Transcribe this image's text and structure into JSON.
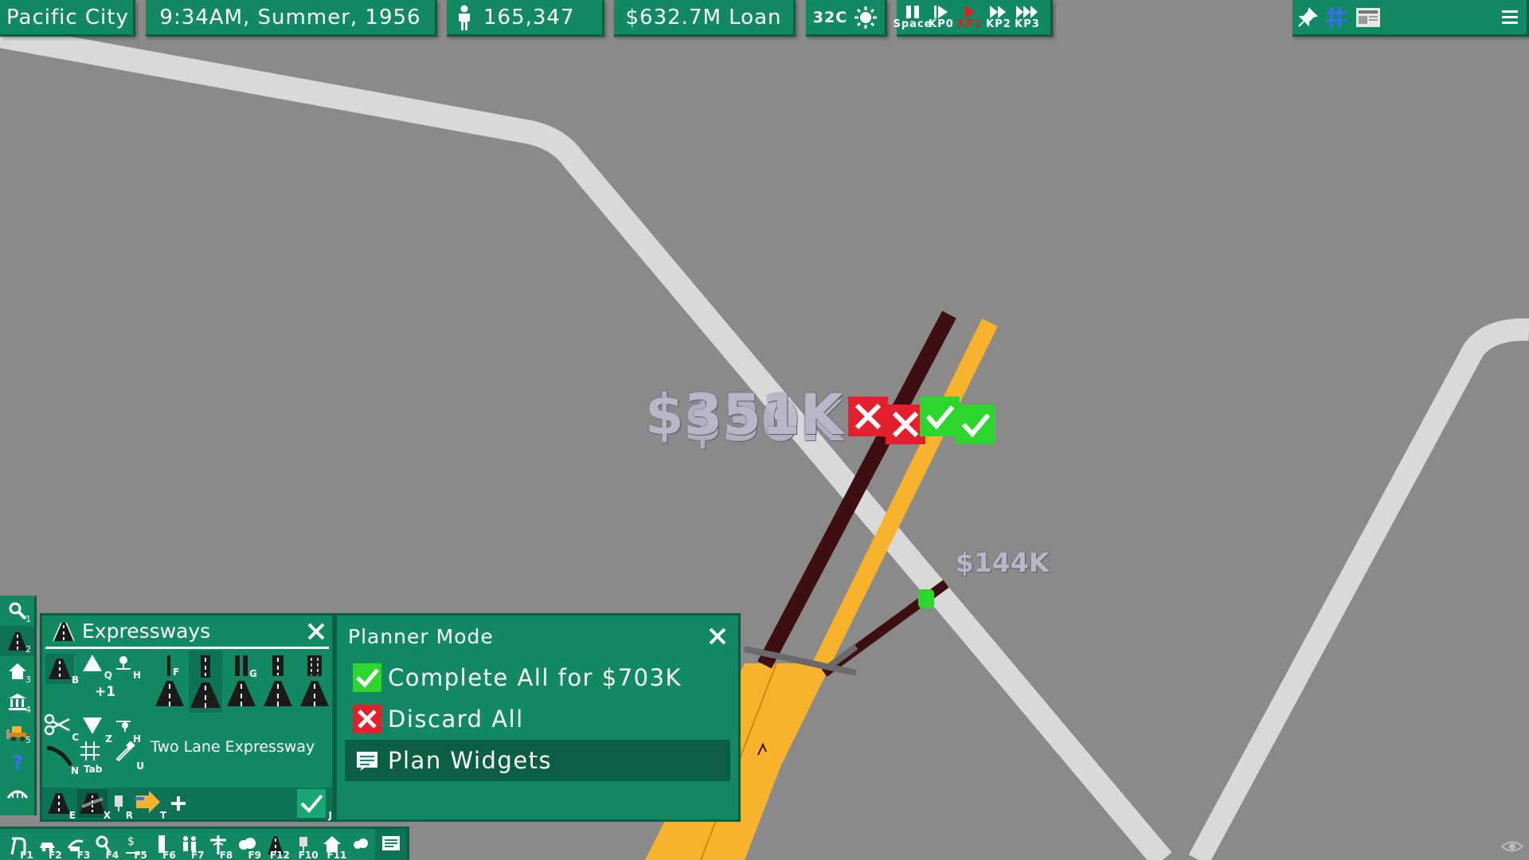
{
  "topbar": {
    "city_name": "Pacific City",
    "datetime": "9:34AM, Summer, 1956",
    "population": "165,347",
    "money": "$632.7M Loan",
    "temperature": "32C",
    "speed_controls": [
      {
        "key": "Space",
        "icon": "pause-icon"
      },
      {
        "key": "KP0",
        "icon": "play-icon"
      },
      {
        "key": "KP1",
        "icon": "speed1-icon",
        "active": true
      },
      {
        "key": "KP2",
        "icon": "speed2-icon"
      },
      {
        "key": "KP3",
        "icon": "speed3-icon"
      }
    ],
    "right_icons": [
      "pin-icon",
      "grid-icon",
      "newspaper-icon",
      "menu-icon"
    ]
  },
  "map": {
    "cost_label_large": "$351K",
    "cost_label_large_overlap": "$30K",
    "cost_label_small": "$144K",
    "colors": {
      "ground": "#8a8a8a",
      "road": "#d9d9d9",
      "expressway_planned": "#f7b32b",
      "expressway_dark": "#3d0f12",
      "accept": "#2cd62c",
      "reject": "#e5202e"
    }
  },
  "left_toolbar": {
    "items": [
      {
        "icon": "magnifier-icon",
        "key": "1"
      },
      {
        "icon": "road-icon",
        "key": "2"
      },
      {
        "icon": "house-icon",
        "key": "3"
      },
      {
        "icon": "government-icon",
        "key": "4"
      },
      {
        "icon": "bulldozer-icon",
        "key": "5"
      },
      {
        "icon": "help-icon",
        "key": ""
      },
      {
        "icon": "terrain-icon",
        "key": ""
      }
    ]
  },
  "expressways_panel": {
    "title": "Expressways",
    "increment_label": "+1",
    "selected_type": "Two Lane Expressway",
    "keys": {
      "b": "B",
      "q": "Q",
      "h": "H",
      "f": "F",
      "g": "G",
      "c": "C",
      "z": "Z",
      "h2": "H",
      "n": "N",
      "tab": "Tab",
      "u": "U",
      "e": "E",
      "x": "X",
      "r": "R",
      "t": "T",
      "j": "J"
    }
  },
  "planner": {
    "title": "Planner Mode",
    "complete_label": "Complete All for $703K",
    "complete_key": "]",
    "discard_label": "Discard All",
    "discard_key": ";",
    "widgets_label": "Plan Widgets",
    "widgets_key": ","
  },
  "bottom_bar": {
    "items": [
      {
        "icon": "road-icon",
        "key": "F1"
      },
      {
        "icon": "car-icon",
        "key": "F2"
      },
      {
        "icon": "rail-icon",
        "key": "F3"
      },
      {
        "icon": "traffic-icon",
        "key": "F4"
      },
      {
        "icon": "budget-icon",
        "key": "F5"
      },
      {
        "icon": "tower-icon",
        "key": "F6"
      },
      {
        "icon": "people-icon",
        "key": "F7"
      },
      {
        "icon": "health-icon",
        "key": "F8"
      },
      {
        "icon": "pollution-icon",
        "key": "F9"
      },
      {
        "icon": "road-zone-icon",
        "key": "F12"
      },
      {
        "icon": "transit-icon",
        "key": "F10"
      },
      {
        "icon": "zone-icon",
        "key": "F11"
      },
      {
        "icon": "weather-icon",
        "key": ""
      },
      {
        "icon": "notes-icon",
        "key": ""
      }
    ]
  }
}
